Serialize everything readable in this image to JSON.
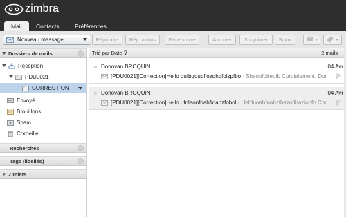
{
  "app": {
    "logo_text": "zimbra"
  },
  "tabs": [
    {
      "label": "Mail",
      "active": true
    },
    {
      "label": "Contacts",
      "active": false
    },
    {
      "label": "Préférences",
      "active": false
    }
  ],
  "toolbar": {
    "new_message": "Nouveau message",
    "buttons": [
      "Répondre",
      "Rép. à tous",
      "Faire suivre",
      "Archiver",
      "Supprimer",
      "Spam"
    ]
  },
  "sidebar": {
    "mail_folders_header": "Dossiers de mails",
    "folders": [
      {
        "label": "Réception",
        "icon": "inbox-icon"
      },
      {
        "label": "PDU0021",
        "icon": "folder-icon"
      },
      {
        "label": "CORRECTION",
        "icon": "folder-icon",
        "selected": true
      },
      {
        "label": "Envoyé",
        "icon": "sent-icon"
      },
      {
        "label": "Brouillons",
        "icon": "drafts-icon"
      },
      {
        "label": "Spam",
        "icon": "spam-icon"
      },
      {
        "label": "Corbeille",
        "icon": "trash-icon"
      }
    ],
    "searches_header": "Recherches",
    "tags_header": "Tags (libellés)",
    "zimlets_header": "Zimlets"
  },
  "list": {
    "sort_label": "Trié par Date",
    "count_label": "2 mails",
    "messages": [
      {
        "sender": "Donovan BROQUIN",
        "date": "04 Avr",
        "subject": "[PDU0021][Correction]Hello qufbqoubfiozqhbfoizpfbo",
        "fragment": " - Sbeobfobeofb Cordialement, Donc"
      },
      {
        "sender": "Donovan BROQUIN",
        "date": "04 Avr",
        "subject": "[PDU0021][Correction]Hello ufnlaonfoabfioabzfobol",
        "fragment": " - Uebfuoabfuabzfbazofibaziobfo Cord"
      }
    ]
  },
  "colors": {
    "header_bg": "#2e2e2e",
    "selected_folder": "#bcd3ea",
    "toolbar_bg": "#e6e6e6"
  }
}
